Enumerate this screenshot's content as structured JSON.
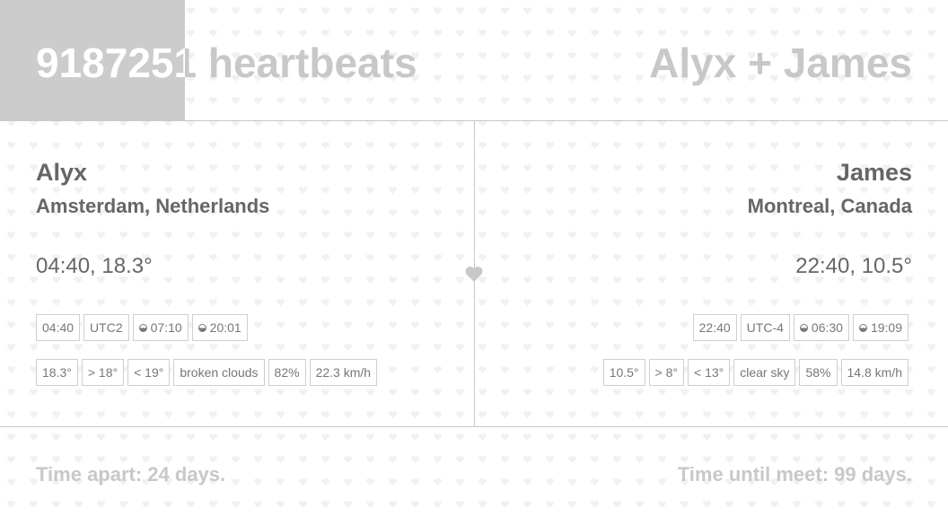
{
  "header": {
    "heartbeat_count": "9187251",
    "heartbeat_suffix": " heartbeats",
    "couple_title": "Alyx + James",
    "progress_fraction": 0.195
  },
  "left_person": {
    "name": "Alyx",
    "location": "Amsterdam, Netherlands",
    "time_temp": "04:40, 18.3°",
    "row1": [
      {
        "text": "04:40",
        "icon": ""
      },
      {
        "text": "UTC2",
        "icon": ""
      },
      {
        "text": "07:10",
        "icon": "sunrise-half-icon"
      },
      {
        "text": "20:01",
        "icon": "sunset-half-icon"
      }
    ],
    "row2": [
      {
        "text": "18.3°"
      },
      {
        "text": "> 18°"
      },
      {
        "text": "< 19°"
      },
      {
        "text": "broken clouds"
      },
      {
        "text": "82%"
      },
      {
        "text": "22.3 km/h"
      }
    ]
  },
  "right_person": {
    "name": "James",
    "location": "Montreal, Canada",
    "time_temp": "22:40, 10.5°",
    "row1": [
      {
        "text": "22:40",
        "icon": ""
      },
      {
        "text": "UTC-4",
        "icon": ""
      },
      {
        "text": "06:30",
        "icon": "sunrise-half-icon"
      },
      {
        "text": "19:09",
        "icon": "sunset-half-icon"
      }
    ],
    "row2": [
      {
        "text": "10.5°"
      },
      {
        "text": "> 8°"
      },
      {
        "text": "< 13°"
      },
      {
        "text": "clear sky"
      },
      {
        "text": "58%"
      },
      {
        "text": "14.8 km/h"
      }
    ]
  },
  "center": {
    "icon": "heart-icon"
  },
  "footer": {
    "time_apart": "Time apart: 24 days.",
    "time_until_meet": "Time until meet: 99 days."
  },
  "colors": {
    "accent_gray": "#c8c8c8",
    "text_gray": "#666666",
    "progress_fill": "#cccccc"
  }
}
